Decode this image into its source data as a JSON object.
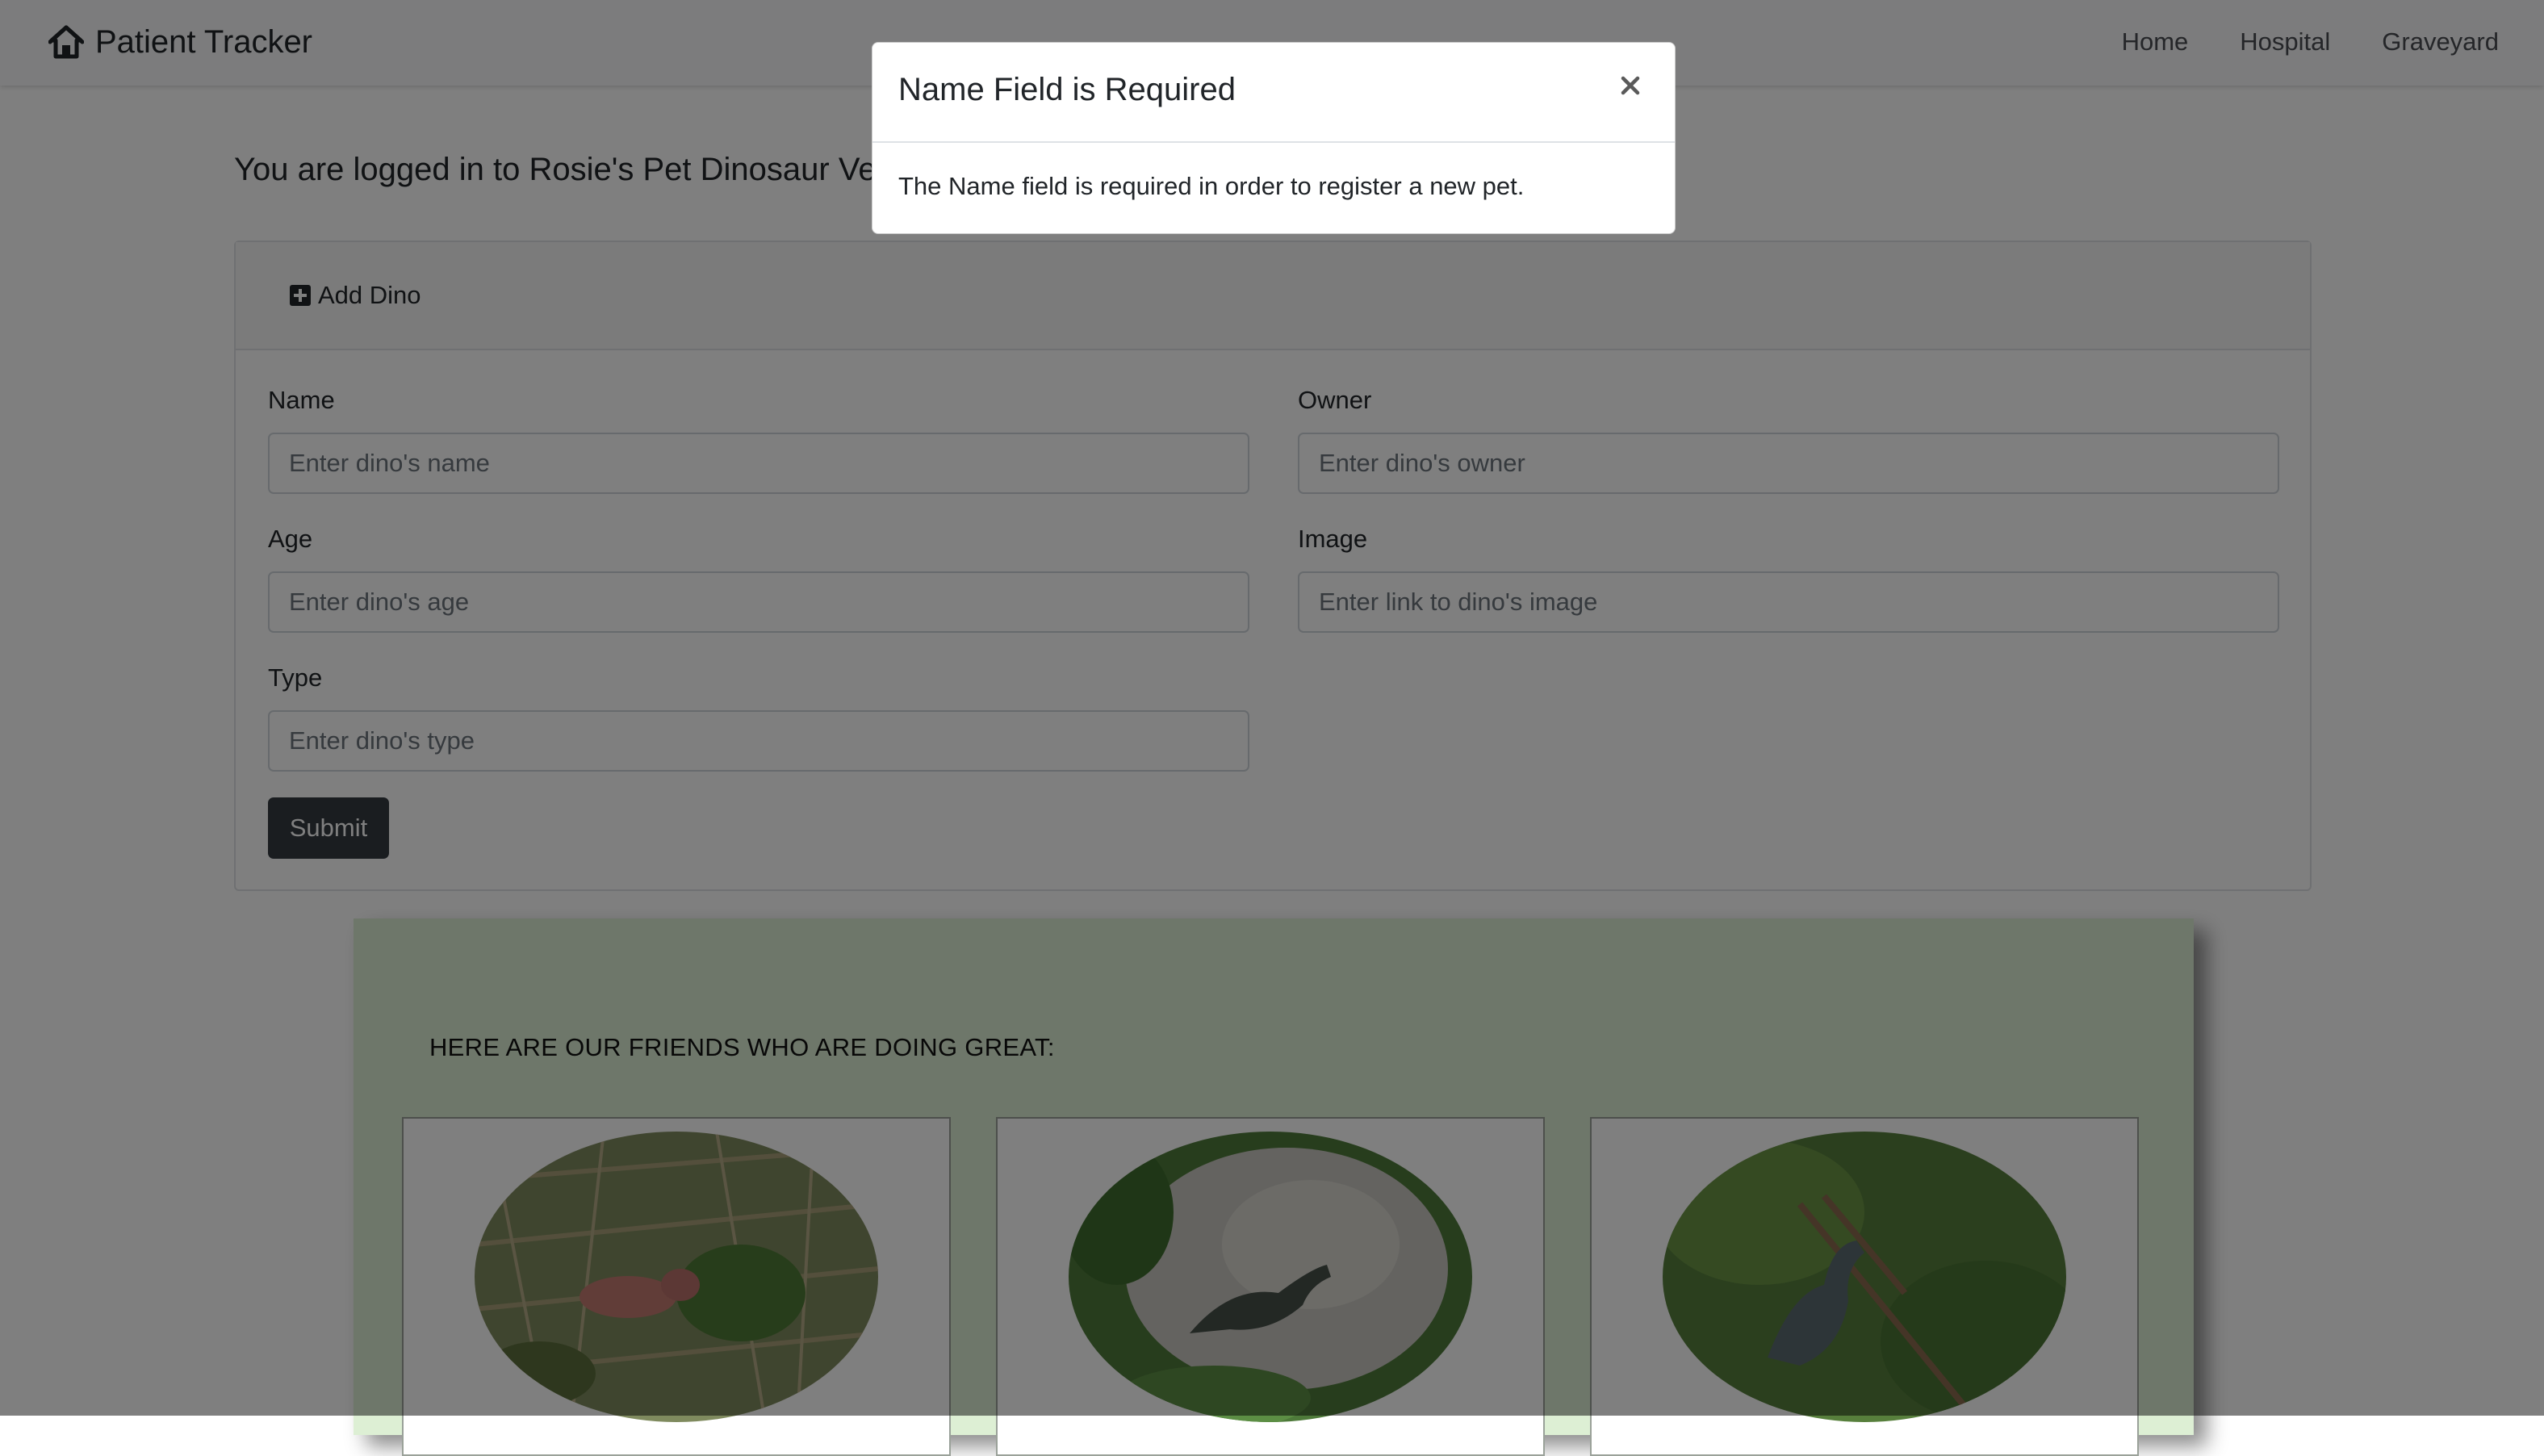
{
  "navbar": {
    "brand": "Patient Tracker",
    "brand_icon": "home-icon",
    "links": [
      "Home",
      "Hospital",
      "Graveyard"
    ]
  },
  "welcome": "You are logged in to Rosie's Pet Dinosaur Veterinary Clinic",
  "form": {
    "header": "Add Dino",
    "header_icon": "plus-square-icon",
    "name": {
      "label": "Name",
      "placeholder": "Enter dino's name"
    },
    "owner": {
      "label": "Owner",
      "placeholder": "Enter dino's owner"
    },
    "age": {
      "label": "Age",
      "placeholder": "Enter dino's age"
    },
    "image": {
      "label": "Image",
      "placeholder": "Enter link to dino's image"
    },
    "type": {
      "label": "Type",
      "placeholder": "Enter dino's type"
    },
    "submit": "Submit"
  },
  "pets": {
    "heading": "HERE ARE OUR FRIENDS WHO ARE DOING GREAT:",
    "section_color": "#ddefd4"
  },
  "modal": {
    "title": "Name Field is Required",
    "body": "The Name field is required in order to register a new pet.",
    "close_icon": "close-icon"
  }
}
